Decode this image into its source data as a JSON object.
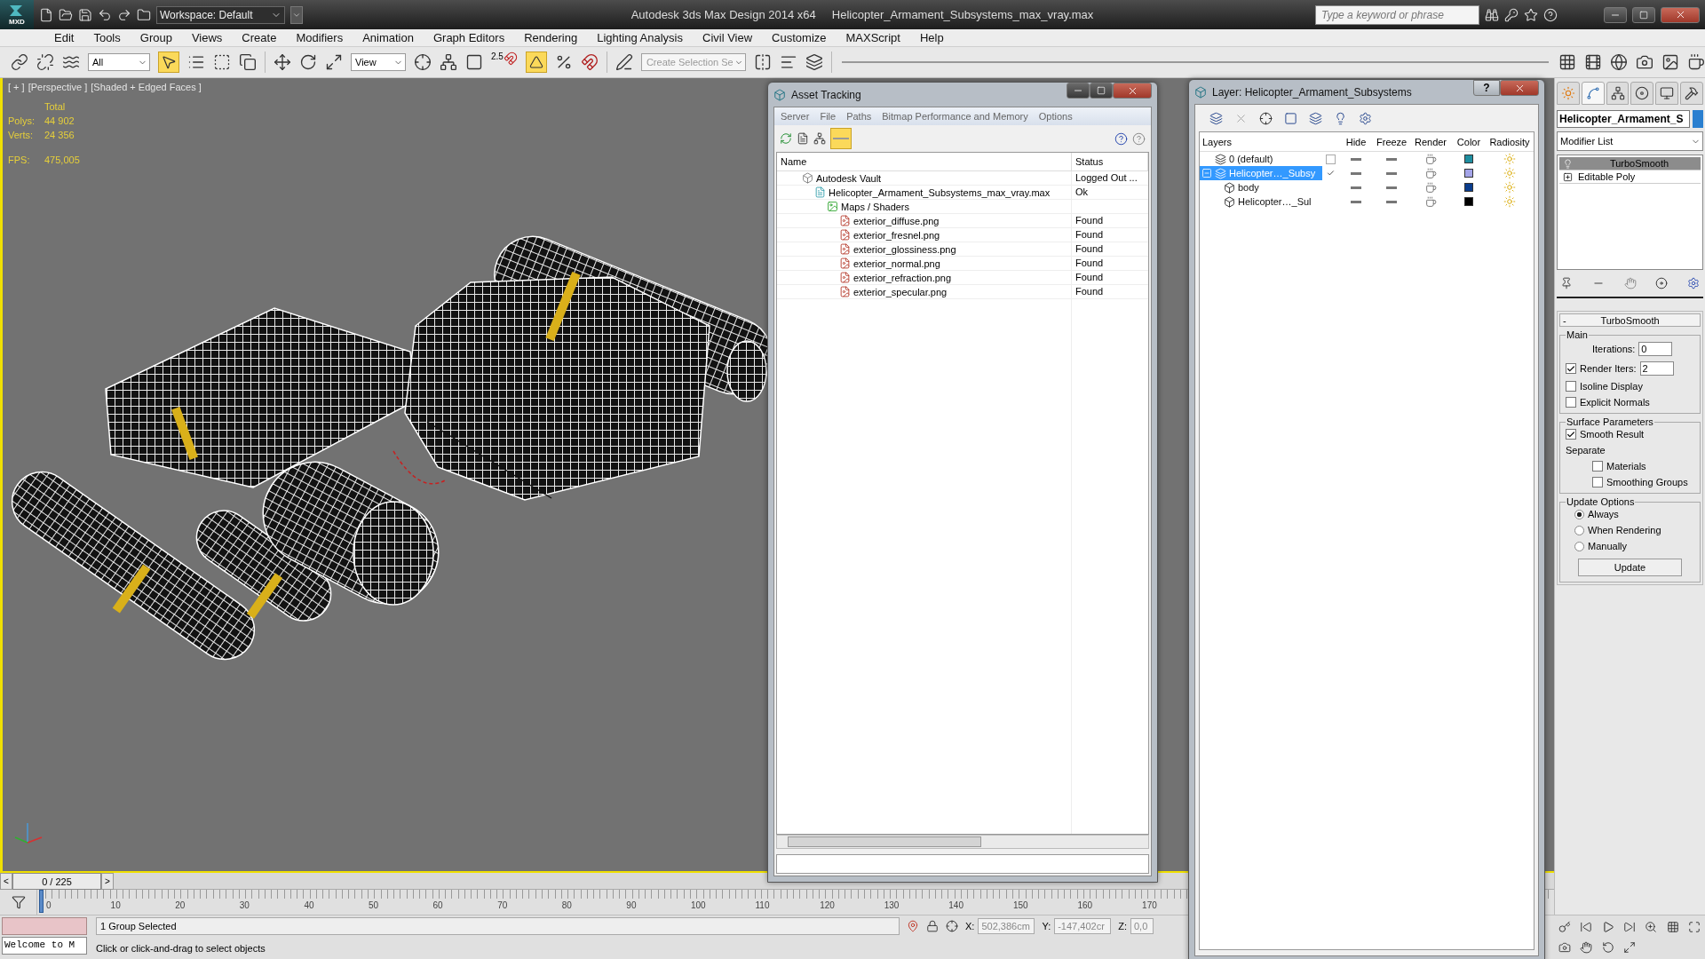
{
  "title_bar": {
    "logo": "MXD",
    "workspace": "Workspace: Default",
    "app_title": "Autodesk 3ds Max Design 2014 x64",
    "file_title": "Helicopter_Armament_Subsystems_max_vray.max",
    "search_placeholder": "Type a keyword or phrase"
  },
  "menu": [
    "Edit",
    "Tools",
    "Group",
    "Views",
    "Create",
    "Modifiers",
    "Animation",
    "Graph Editors",
    "Rendering",
    "Lighting Analysis",
    "Civil View",
    "Customize",
    "MAXScript",
    "Help"
  ],
  "toolbar": {
    "selection_filter": "All",
    "reference_coordinate": "View",
    "snap_value": "2.5",
    "selection_set_placeholder": "Create Selection Se",
    "select_object_on": true,
    "angle_snap_on": true
  },
  "viewport": {
    "labels": [
      "[ + ]",
      "[Perspective ]",
      "[Shaded + Edged Faces ]"
    ],
    "active": true,
    "stats_heading": "Total",
    "stats": [
      {
        "label": "Polys:",
        "value": "44 902"
      },
      {
        "label": "Verts:",
        "value": "24 356"
      }
    ],
    "fps_label": "FPS:",
    "fps_value": "475,005"
  },
  "asset_tracking": {
    "title": "Asset Tracking",
    "menu": [
      "Server",
      "File",
      "Paths",
      "Bitmap Performance and Memory",
      "Options"
    ],
    "table_view_on": true,
    "columns": [
      "Name",
      "Status"
    ],
    "tree": [
      {
        "kind": "vault",
        "name": "Autodesk Vault",
        "status": "Logged Out ...",
        "children": [
          {
            "kind": "scene",
            "name": "Helicopter_Armament_Subsystems_max_vray.max",
            "status": "Ok",
            "children": [
              {
                "kind": "folder",
                "name": "Maps / Shaders",
                "children": [
                  {
                    "kind": "file",
                    "name": "exterior_diffuse.png",
                    "status": "Found"
                  },
                  {
                    "kind": "file",
                    "name": "exterior_fresnel.png",
                    "status": "Found"
                  },
                  {
                    "kind": "file",
                    "name": "exterior_glossiness.png",
                    "status": "Found"
                  },
                  {
                    "kind": "file",
                    "name": "exterior_normal.png",
                    "status": "Found"
                  },
                  {
                    "kind": "file",
                    "name": "exterior_refraction.png",
                    "status": "Found"
                  },
                  {
                    "kind": "file",
                    "name": "exterior_specular.png",
                    "status": "Found"
                  }
                ]
              }
            ]
          }
        ]
      }
    ]
  },
  "layer_manager": {
    "title": "Layer: Helicopter_Armament_Subsystems",
    "help": "?",
    "columns": [
      "Layers",
      "Hide",
      "Freeze",
      "Render",
      "Color",
      "Radiosity"
    ],
    "layers": [
      {
        "kind": "layer",
        "name": "0 (default)",
        "selected": false,
        "current": false,
        "expanded": false,
        "hidden": false,
        "frozen": false,
        "color": "#1e8ea0"
      },
      {
        "kind": "layer",
        "name": "Helicopter…_Subsy",
        "selected": true,
        "current": true,
        "expanded": true,
        "hidden": false,
        "frozen": false,
        "color": "#a4a4e8",
        "children": [
          {
            "kind": "object",
            "name": "body",
            "selected": false,
            "hidden": false,
            "frozen": false,
            "color": "#0a3c8c"
          },
          {
            "kind": "object",
            "name": "Helicopter…_Sul",
            "selected": false,
            "hidden": false,
            "frozen": false,
            "color": "#000000"
          }
        ]
      }
    ]
  },
  "command_panel": {
    "object_name": "Helicopter_Armament_S",
    "modifier_list": "Modifier List",
    "stack": [
      {
        "kind": "modifier",
        "name": "TurboSmooth",
        "selected": true
      },
      {
        "kind": "base",
        "name": "Editable Poly",
        "selected": false
      }
    ],
    "rollout": {
      "collapse": "-",
      "title": "TurboSmooth",
      "main": {
        "label": "Main",
        "iterations_label": "Iterations:",
        "iterations": "0",
        "render_iters_label": "Render Iters:",
        "render_iters_checked": true,
        "render_iters": "2",
        "options": [
          {
            "label": "Isoline Display",
            "checked": false
          },
          {
            "label": "Explicit Normals",
            "checked": false
          }
        ]
      },
      "surface": {
        "label": "Surface Parameters",
        "smooth_result": {
          "label": "Smooth Result",
          "checked": true
        },
        "separate_label": "Separate",
        "separate": [
          {
            "label": "Materials",
            "checked": false
          },
          {
            "label": "Smoothing Groups",
            "checked": false
          }
        ]
      },
      "update": {
        "label": "Update Options",
        "modes": [
          {
            "label": "Always",
            "selected": true
          },
          {
            "label": "When Rendering",
            "selected": false
          },
          {
            "label": "Manually",
            "selected": false
          }
        ],
        "button": "Update"
      }
    }
  },
  "time_slider": {
    "prev": "<",
    "position": "0 / 225",
    "next": ">",
    "level": 0
  },
  "track_bar": {
    "ticks": [
      "0",
      "10",
      "20",
      "30",
      "40",
      "50",
      "60",
      "70",
      "80",
      "90",
      "100",
      "110",
      "120",
      "130",
      "140",
      "150",
      "160",
      "170"
    ]
  },
  "status_bar": {
    "listener": "Welcome to M",
    "selection": "1 Group Selected",
    "prompt": "Click or click-and-drag to select objects",
    "x_label": "X:",
    "x_value": "502,386cm",
    "y_label": "Y:",
    "y_value": "-147,402cr",
    "z_label": "Z:",
    "z_value": "0,0"
  }
}
